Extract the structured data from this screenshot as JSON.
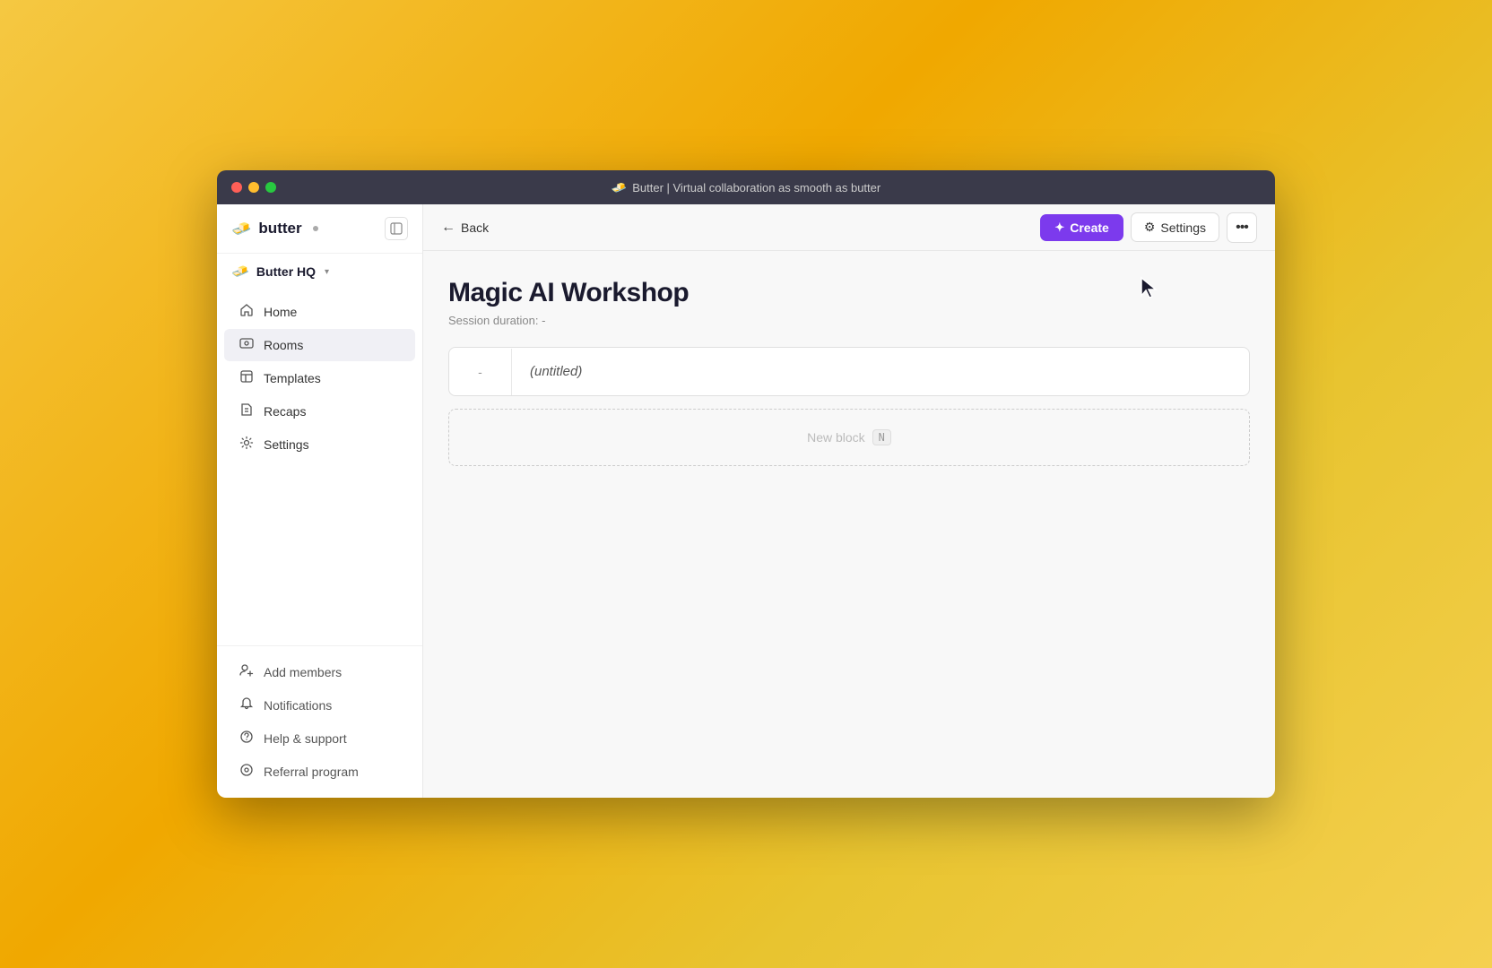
{
  "browser": {
    "title": "Butter | Virtual collaboration as smooth as butter",
    "favicon": "🧈"
  },
  "sidebar": {
    "logo": "butter",
    "logo_icon": "🧈",
    "status_dot": true,
    "workspace_name": "Butter HQ",
    "collapse_btn": "⊞",
    "nav_items": [
      {
        "id": "home",
        "label": "Home",
        "icon": "⌂",
        "active": false
      },
      {
        "id": "rooms",
        "label": "Rooms",
        "icon": "⊡",
        "active": true
      },
      {
        "id": "templates",
        "label": "Templates",
        "icon": "☰",
        "active": false
      },
      {
        "id": "recaps",
        "label": "Recaps",
        "icon": "📁",
        "active": false
      },
      {
        "id": "settings",
        "label": "Settings",
        "icon": "⚙",
        "active": false
      }
    ],
    "bottom_items": [
      {
        "id": "add-members",
        "label": "Add members",
        "icon": "👤"
      },
      {
        "id": "notifications",
        "label": "Notifications",
        "icon": "🔔"
      },
      {
        "id": "help",
        "label": "Help & support",
        "icon": "❓"
      },
      {
        "id": "referral",
        "label": "Referral program",
        "icon": "⭕"
      }
    ]
  },
  "topbar": {
    "back_label": "Back",
    "create_label": "Create",
    "create_icon": "✦",
    "settings_label": "Settings",
    "settings_icon": "⚙",
    "more_icon": "···"
  },
  "session": {
    "title": "Magic AI Workshop",
    "duration_label": "Session duration:",
    "duration_value": "-",
    "agenda_item": {
      "duration": "-",
      "title": "(untitled)"
    },
    "new_block_label": "New block",
    "new_block_shortcut": "N"
  }
}
